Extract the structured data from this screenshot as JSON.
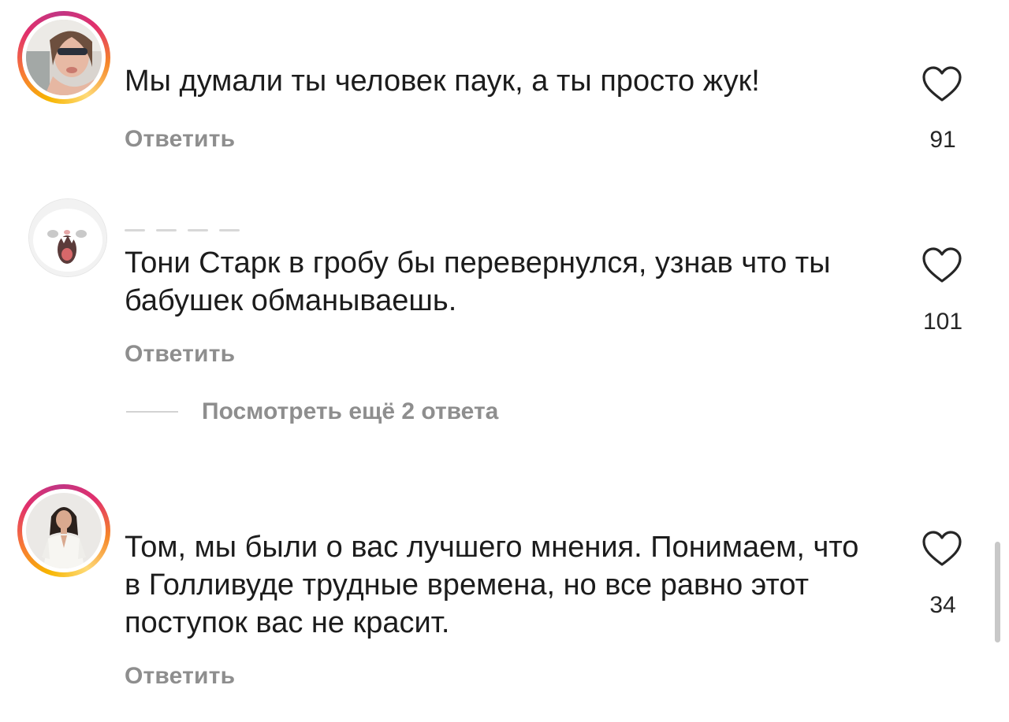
{
  "comments": [
    {
      "text": "Мы думали ты человек паук, а ты просто жук!",
      "reply_label": "Ответить",
      "likes": "91",
      "avatar_style": "story-ring"
    },
    {
      "text": "Тони Старк в гробу бы перевернулся, узнав что ты бабушек обманываешь.",
      "reply_label": "Ответить",
      "likes": "101",
      "avatar_style": "plain"
    },
    {
      "text": "Том, мы были о вас лучшего мнения. Понимаем, что в Голливуде трудные времена, но все равно этот поступок вас не красит.",
      "reply_label": "Ответить",
      "likes": "34",
      "avatar_style": "story-ring"
    }
  ],
  "view_replies_label": "Посмотреть ещё 2 ответа",
  "colors": {
    "text": "#1c1c1c",
    "secondary": "#8e8e8e",
    "ring_start": "#f7b500",
    "ring_end": "#c13584"
  },
  "icons": {
    "like": "heart-outline-icon"
  }
}
